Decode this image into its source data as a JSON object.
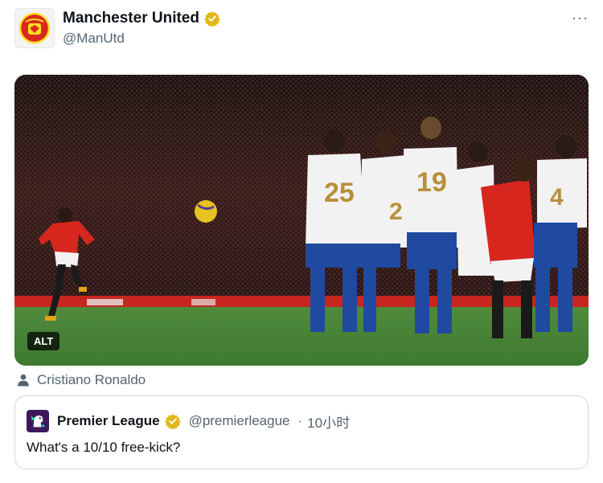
{
  "author": {
    "display_name": "Manchester United",
    "handle": "@ManUtd",
    "avatar_icon": "manchester-united-crest-icon",
    "verified": true,
    "verified_color": "#e2b719"
  },
  "more_label": "···",
  "media": {
    "alt_label": "ALT",
    "description_icon": "photo"
  },
  "tagged": {
    "icon": "person-icon",
    "name": "Cristiano Ronaldo"
  },
  "quoted_post": {
    "display_name": "Premier League",
    "handle": "@premierleague",
    "separator": "·",
    "time": "10小时",
    "text": "What's a 10/10 free-kick?",
    "avatar_icon": "premier-league-lion-icon",
    "verified": true
  },
  "colors": {
    "text_primary": "#0f1419",
    "text_secondary": "#536471",
    "border": "#cfd9de",
    "verified_gold": "#e2b719"
  }
}
